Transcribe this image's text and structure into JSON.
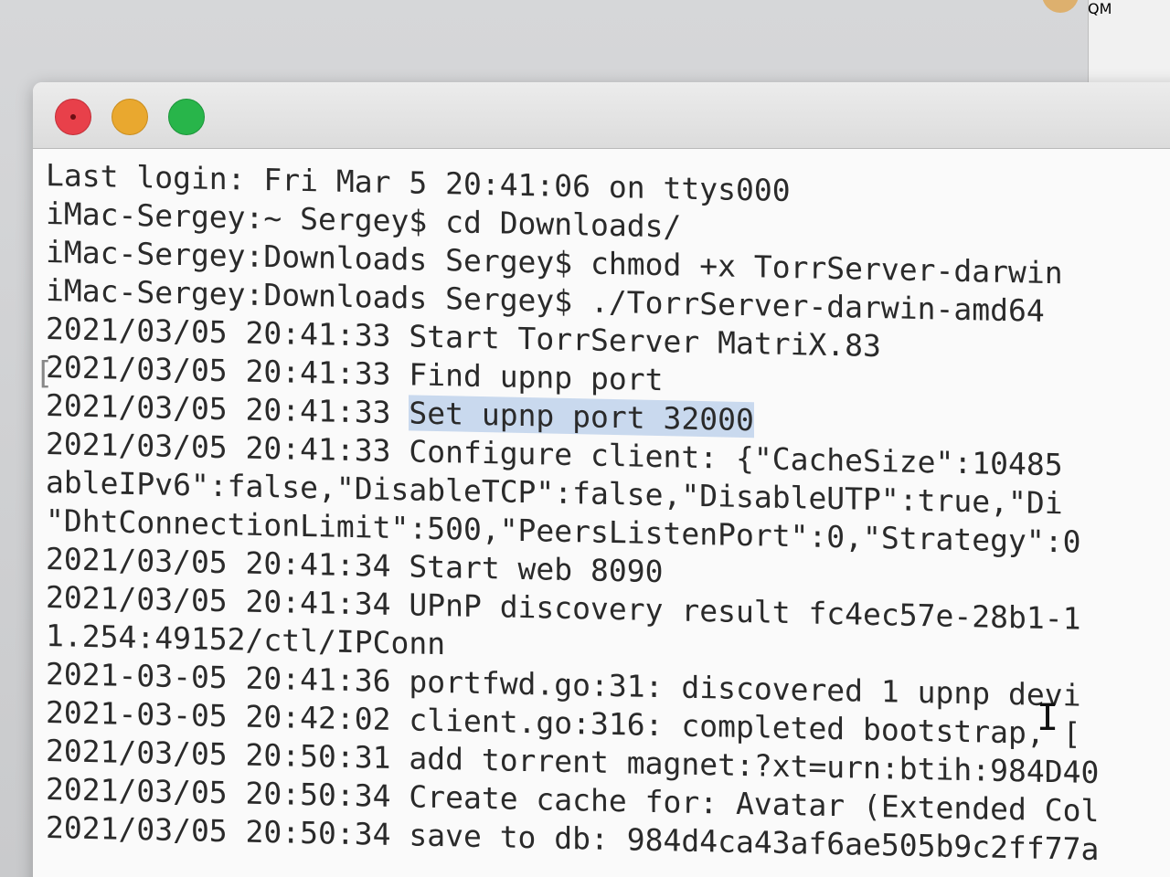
{
  "background": {
    "partial_title": "QM"
  },
  "terminal": {
    "buttons": {
      "close": "close",
      "minimize": "minimize",
      "zoom": "zoom"
    },
    "lines": [
      "Last login: Fri Mar  5 20:41:06 on ttys000",
      "iMac-Sergey:~ Sergey$ cd Downloads/",
      "iMac-Sergey:Downloads Sergey$ chmod +x TorrServer-darwin",
      "iMac-Sergey:Downloads Sergey$ ./TorrServer-darwin-amd64",
      "2021/03/05 20:41:33 Start TorrServer MatriX.83",
      "2021/03/05 20:41:33 Find upnp port",
      "2021/03/05 20:41:33 ",
      "2021/03/05 20:41:33 Configure client: {\"CacheSize\":10485",
      "ableIPv6\":false,\"DisableTCP\":false,\"DisableUTP\":true,\"Di",
      "\"DhtConnectionLimit\":500,\"PeersListenPort\":0,\"Strategy\":0",
      "2021/03/05 20:41:34 Start web 8090",
      "2021/03/05 20:41:34 UPnP discovery result fc4ec57e-28b1-1",
      "1.254:49152/ctl/IPConn",
      "2021-03-05 20:41:36 portfwd.go:31: discovered 1 upnp devi",
      "2021-03-05 20:42:02 client.go:316: completed bootstrap, [",
      "2021/03/05 20:50:31 add torrent magnet:?xt=urn:btih:984D40",
      "2021/03/05 20:50:34 Create cache for: Avatar (Extended Col",
      "2021/03/05 20:50:34 save to db: 984d4ca43af6ae505b9c2ff77a"
    ],
    "highlighted_text": "Set upnp port 32000"
  }
}
